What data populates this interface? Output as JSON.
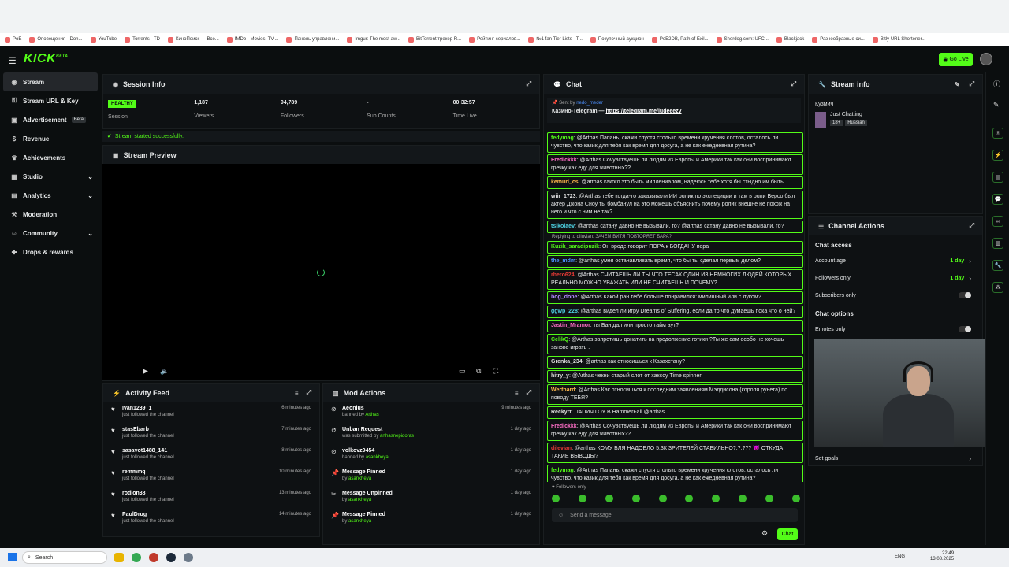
{
  "bookmarks": [
    "PoE",
    "Оповещения - Don...",
    "YouTube",
    "Torrents - TD",
    "КиноПоиск — Все...",
    "IMDb - Movies, TV,...",
    "Панель управлени...",
    "Imgur: The most aw...",
    "BitTorrent трекер R...",
    "Рейтинг сериалов...",
    "№1 fan Tier Lists - T...",
    "Покупочный аукцион",
    "PoE2DB, Path of Exil...",
    "Sherdog.com: UFC...",
    "Blackjack",
    "Разнообразные си...",
    "Bitly URL Shortener..."
  ],
  "app": {
    "logo": "KICK",
    "logo_tag": "BETA",
    "go_live": "Go Live"
  },
  "sidebar": {
    "items": [
      {
        "label": "Stream",
        "icon": "broadcast-icon"
      },
      {
        "label": "Stream URL & Key",
        "icon": "key-icon"
      },
      {
        "label": "Advertisement",
        "badge": "Beta",
        "icon": "ad-icon"
      },
      {
        "label": "Revenue",
        "icon": "dollar-icon"
      },
      {
        "label": "Achievements",
        "icon": "trophy-icon"
      },
      {
        "label": "Studio",
        "icon": "studio-icon"
      },
      {
        "label": "Analytics",
        "icon": "chart-icon"
      },
      {
        "label": "Moderation",
        "icon": "hammer-icon"
      },
      {
        "label": "Community",
        "icon": "people-icon"
      },
      {
        "label": "Drops & rewards",
        "icon": "gift-icon"
      }
    ]
  },
  "session": {
    "title": "Session Info",
    "status": "HEALTHY",
    "status_label": "Session",
    "stats": [
      {
        "value": "1,187",
        "label": "Viewers"
      },
      {
        "value": "94,789",
        "label": "Followers"
      },
      {
        "value": "-",
        "label": "Sub Counts"
      },
      {
        "value": "00:32:57",
        "label": "Time Live"
      }
    ],
    "success": "Stream started successfully."
  },
  "preview": {
    "title": "Stream Preview"
  },
  "activity": {
    "title": "Activity Feed",
    "items": [
      {
        "name": "Ivan1239_1",
        "sub": "just followed the channel",
        "time": "6 minutes ago"
      },
      {
        "name": "stasEbarb",
        "sub": "just followed the channel",
        "time": "7 minutes ago"
      },
      {
        "name": "sasavot1488_141",
        "sub": "just followed the channel",
        "time": "8 minutes ago"
      },
      {
        "name": "remmmq",
        "sub": "just followed the channel",
        "time": "10 minutes ago"
      },
      {
        "name": "rodion38",
        "sub": "just followed the channel",
        "time": "13 minutes ago"
      },
      {
        "name": "PaulDrug",
        "sub": "just followed the channel",
        "time": "14 minutes ago"
      }
    ]
  },
  "mod": {
    "title": "Mod Actions",
    "items": [
      {
        "name": "Aeonius",
        "prefix": "banned by",
        "by": "Arthas",
        "time": "9 minutes ago"
      },
      {
        "name": "Unban Request",
        "prefix": "was submitted by",
        "by": "arthasnepidoras",
        "time": "1 day ago"
      },
      {
        "name": "volkovz9454",
        "prefix": "banned by",
        "by": "asankheya",
        "time": "1 day ago"
      },
      {
        "name": "Message Pinned",
        "prefix": "by",
        "by": "asankheya",
        "time": "1 day ago"
      },
      {
        "name": "Message Unpinned",
        "prefix": "by",
        "by": "asankheya",
        "time": "1 day ago"
      },
      {
        "name": "Message Pinned",
        "prefix": "by",
        "by": "asankheya",
        "time": "1 day ago"
      }
    ]
  },
  "chat": {
    "title": "Chat",
    "pinned": {
      "sent": "Sent by",
      "sender": "nedo_meder",
      "text": "Казино-Telegram — ",
      "link": "https://telegram.me/ludeeezy"
    },
    "messages": [
      {
        "user": "fedymag",
        "color": "#53fc18",
        "text": ": @Arthas Папань, скажи спустя столько времени кручения слотов, осталось ли чувство, что казик для тебя как время для досуга, а не как ежедневная рутина?"
      },
      {
        "user": "Fredickkk",
        "color": "#ff6ec7",
        "text": ": @Arthas Сочувствуешь ли людям из Европы и Америки так как они воспринимают гречку как еду для животных??"
      },
      {
        "user": "kemuri_cs",
        "color": "#ffb84d",
        "text": ": @arthas какого это быть миллениалом, надеюсь тебе хотя бы стыдно им быть"
      },
      {
        "user": "wiir_1723",
        "color": "#ddd",
        "text": ": @Arthas тебе когда-то заказывали ИИ ролик по экспедиции и там в роли Версо был актер Джона Сноу ты бомбанул на это можешь объяснить почему ролик внешне не похож на него и что с ним не так?"
      },
      {
        "user": "tsikolaev",
        "color": "#4dd0e1",
        "text": ": @arthas сатану давно не вызывали, го? @arthas сатану давно не вызывали, го?"
      },
      {
        "user": "Kuzik_saradipuzik",
        "color": "#53fc18",
        "text": ": Он вроде говорит ПОРА к БОГДАНУ пора",
        "reply": "Replying to dlluvian: ЗАЧЕМ ВИТЯ ПОВТОРЯЕТ БАРА?"
      },
      {
        "user": "the_mdm",
        "color": "#4d90fe",
        "text": ": @arthas умея останавливать время, что бы ты сделал первым делом?"
      },
      {
        "user": "rhero624",
        "color": "#e53935",
        "text": ": @Arthas СЧИТАЕШЬ ЛИ ТЫ ЧТО ТЕСАК ОДИН ИЗ НЕМНОГИХ ЛЮДЕЙ КОТОРЫХ РЕАЛЬНО МОЖНО УВАЖАТЬ ИЛИ НЕ СЧИТАЕШЬ И ПОЧЕМУ?"
      },
      {
        "user": "bog_done",
        "color": "#b388ff",
        "text": ": @Arthas Какой ран тебе больше понравился: милишный или с луком?"
      },
      {
        "user": "ggwp_228",
        "color": "#4dd0e1",
        "text": ": @arthas видел ли игру Dreams of Suffering, если да то что думаешь пока что о ней?"
      },
      {
        "user": "Jastin_Mramor",
        "color": "#ff6ec7",
        "text": ": ты Бан дал или просто тайм аут?"
      },
      {
        "user": "CelikQ",
        "color": "#53fc18",
        "text": ": @Arthas запретишь донатить на продолжение готики ?Ты же сам особо не хочешь заново играть ."
      },
      {
        "user": "Grenka_234",
        "color": "#ddd",
        "text": ": @arthas как относишься к Казахстану?"
      },
      {
        "user": "hitry_y",
        "color": "#ddd",
        "text": ": @Arthas чекни старый слот от хаксоу Time spinner"
      },
      {
        "user": "Werthard",
        "color": "#ffb84d",
        "text": ": @Arthas Как относишься к последним заявлениям Мэддисона (короля рунета) по поводу ТЕБЯ?"
      },
      {
        "user": "Reckyrt",
        "color": "#ddd",
        "text": ": ПАПИЧ ГОУ В HammerFall @arthas"
      },
      {
        "user": "Fredickkk",
        "color": "#ff6ec7",
        "text": ": @Arthas Сочувствуешь ли людям из Европы и Америки так как они воспринимают гречку как еду для животных??"
      },
      {
        "user": "dilevian",
        "color": "#e53935",
        "text": ": @arthas КОМУ БЛЯ НАДОЕЛО 5.3К ЗРИТЕЛЕЙ СТАБИЛЬНО?.?.??? 😈 ОТКУДА ТАКИЕ ВЫВОДЫ?"
      },
      {
        "user": "fedymag",
        "color": "#53fc18",
        "text": ": @Arthas Папань, скажи спустя столько времени кручения слотов, осталось ли чувство, что казик для тебя как время для досуга, а не как ежедневная рутина?"
      }
    ],
    "followers_only": "Followers only",
    "send_placeholder": "Send a message",
    "send_label": "Chat"
  },
  "stream_info": {
    "title": "Stream info",
    "name": "Кузмич",
    "category": "Just Chatting",
    "tags": [
      "18+",
      "Russian"
    ]
  },
  "channel_actions": {
    "title": "Channel Actions",
    "access_title": "Chat access",
    "access": [
      {
        "label": "Account age",
        "value": "1 day"
      },
      {
        "label": "Followers only",
        "value": "1 day"
      },
      {
        "label": "Subscribers only",
        "value": ""
      }
    ],
    "options_title": "Chat options",
    "options": [
      {
        "label": "Emotes only"
      }
    ],
    "set_goals": "Set goals"
  },
  "taskbar": {
    "search": "Search",
    "lang": "ENG",
    "time": "22:49",
    "date": "13.08.2025"
  }
}
